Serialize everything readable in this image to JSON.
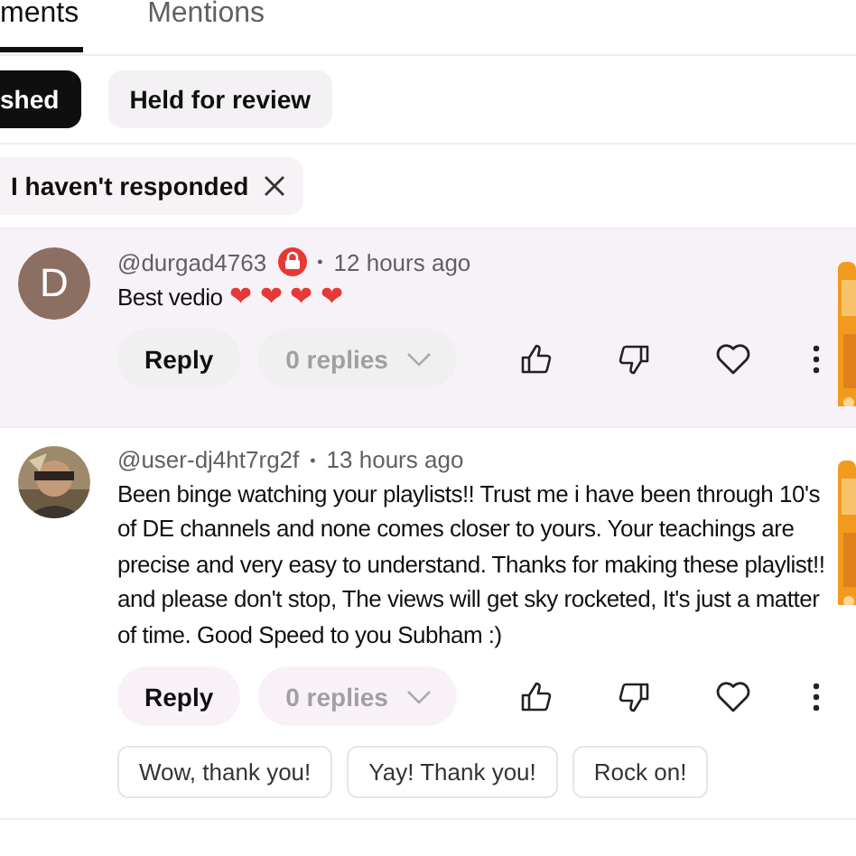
{
  "tabs": [
    {
      "label": "ments",
      "selected": true
    },
    {
      "label": "Mentions",
      "selected": false
    }
  ],
  "status_chips": [
    {
      "label": "shed",
      "selected": true
    },
    {
      "label": "Held for review",
      "selected": false
    }
  ],
  "filter_chip": {
    "label": "I haven't responded"
  },
  "comments": [
    {
      "avatar": {
        "kind": "letter",
        "letter": "D",
        "color": "#8d6e63"
      },
      "author": "@durgad4763",
      "member_badge": true,
      "separator": "•",
      "time": "12 hours ago",
      "text": "Best vedio",
      "emoji": [
        "❤",
        "❤",
        "❤",
        "❤"
      ],
      "highlighted": true,
      "reply": "Reply",
      "replies": "0 replies"
    },
    {
      "avatar": {
        "kind": "picture"
      },
      "author": "@user-dj4ht7rg2f",
      "member_badge": false,
      "separator": "•",
      "time": "13 hours ago",
      "text": "Been binge watching your playlists!! Trust me i have been through 10's of DE channels and none comes closer to yours. Your teachings are precise and very easy to understand. Thanks for making these playlist!! and please don't stop, The views will get sky rocketed,  It's just a matter of time. Good Speed to you Subham :)",
      "highlighted": false,
      "reply": "Reply",
      "replies": "0 replies",
      "suggestions": [
        "Wow, thank you!",
        "Yay! Thank you!",
        "Rock on!"
      ]
    }
  ]
}
